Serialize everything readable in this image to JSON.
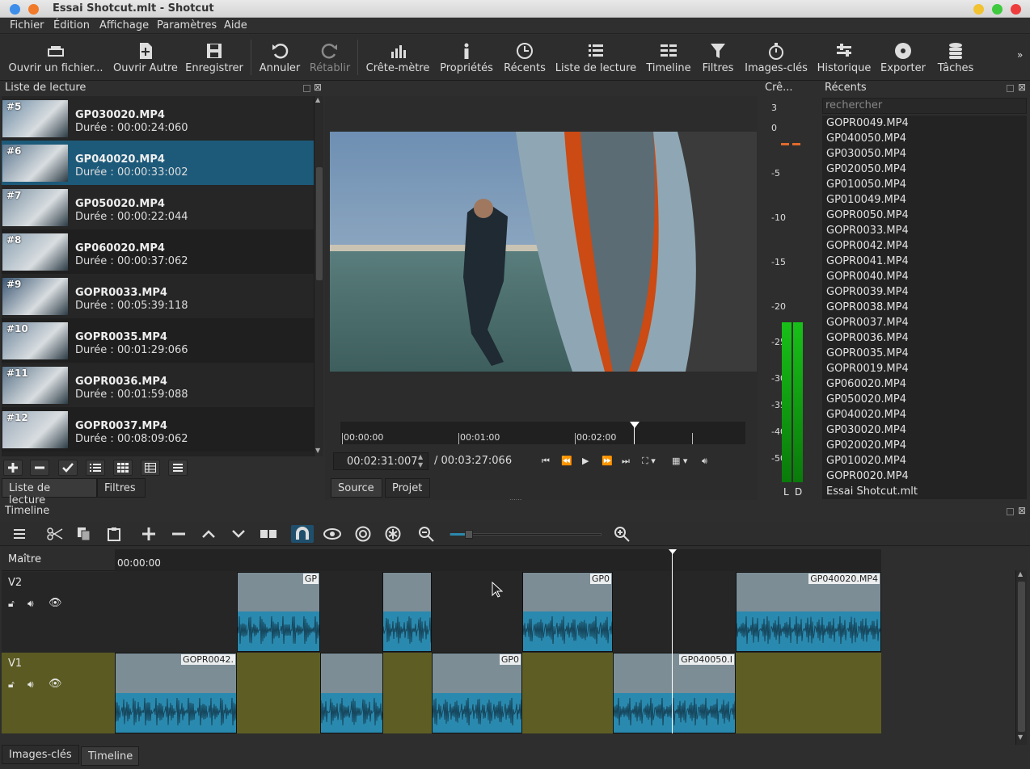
{
  "window": {
    "title": "Essai Shotcut.mlt - Shotcut"
  },
  "menu": [
    "Fichier",
    "Édition",
    "Affichage",
    "Paramètres",
    "Aide"
  ],
  "toolbar": {
    "open_file": "Ouvrir un fichier...",
    "open_other": "Ouvrir Autre",
    "save": "Enregistrer",
    "undo": "Annuler",
    "redo": "Rétablir",
    "peak_meter": "Crête-mètre",
    "properties": "Propriétés",
    "recent": "Récents",
    "playlist": "Liste de lecture",
    "timeline": "Timeline",
    "filters": "Filtres",
    "keyframes": "Images-clés",
    "history": "Historique",
    "export": "Exporter",
    "jobs": "Tâches"
  },
  "playlist_panel": {
    "title": "Liste de lecture",
    "items": [
      {
        "num": "#5",
        "name": "GP030020.MP4",
        "duration": "Durée : 00:00:24:060"
      },
      {
        "num": "#6",
        "name": "GP040020.MP4",
        "duration": "Durée : 00:00:33:002"
      },
      {
        "num": "#7",
        "name": "GP050020.MP4",
        "duration": "Durée : 00:00:22:044"
      },
      {
        "num": "#8",
        "name": "GP060020.MP4",
        "duration": "Durée : 00:00:37:062"
      },
      {
        "num": "#9",
        "name": "GOPR0033.MP4",
        "duration": "Durée : 00:05:39:118"
      },
      {
        "num": "#10",
        "name": "GOPR0035.MP4",
        "duration": "Durée : 00:01:29:066"
      },
      {
        "num": "#11",
        "name": "GOPR0036.MP4",
        "duration": "Durée : 00:01:59:088"
      },
      {
        "num": "#12",
        "name": "GOPR0037.MP4",
        "duration": "Durée : 00:08:09:062"
      }
    ],
    "selected_index": 1,
    "tabs": [
      "Liste de lecture",
      "Filtres"
    ]
  },
  "player": {
    "ruler": [
      "00:00:00",
      "00:01:00",
      "00:02:00"
    ],
    "position": "00:02:31:007",
    "duration": "/ 00:03:27:066",
    "tabs": [
      "Source",
      "Projet"
    ]
  },
  "meter": {
    "title": "Crê...",
    "labels": [
      "3",
      "0",
      "-5",
      "-10",
      "-15",
      "-20",
      "-25",
      "-30",
      "-35",
      "-40",
      "-50"
    ],
    "left": "L",
    "right": "D"
  },
  "recent_panel": {
    "title": "Récents",
    "search_placeholder": "rechercher",
    "items": [
      "GOPR0049.MP4",
      "GP040050.MP4",
      "GP030050.MP4",
      "GP020050.MP4",
      "GP010050.MP4",
      "GP010049.MP4",
      "GOPR0050.MP4",
      "GOPR0033.MP4",
      "GOPR0042.MP4",
      "GOPR0041.MP4",
      "GOPR0040.MP4",
      "GOPR0039.MP4",
      "GOPR0038.MP4",
      "GOPR0037.MP4",
      "GOPR0036.MP4",
      "GOPR0035.MP4",
      "GOPR0019.MP4",
      "GP060020.MP4",
      "GP050020.MP4",
      "GP040020.MP4",
      "GP030020.MP4",
      "GP020020.MP4",
      "GP010020.MP4",
      "GOPR0020.MP4",
      "Essai Shotcut.mlt"
    ]
  },
  "timeline": {
    "title": "Timeline",
    "master": "Maître",
    "timecode_start": "00:00:00",
    "tracks": [
      {
        "name": "V2"
      },
      {
        "name": "V1"
      }
    ],
    "v2_clips": [
      {
        "label": "GP"
      },
      {
        "label": ""
      },
      {
        "label": "GP0"
      },
      {
        "label": "GP040020.MP4"
      }
    ],
    "v1_clips": [
      {
        "label": "GOPR0042."
      },
      {
        "label": ""
      },
      {
        "label": "GP0"
      },
      {
        "label": "GP040050.I"
      }
    ]
  },
  "bottom_tabs": [
    "Images-clés",
    "Timeline"
  ]
}
